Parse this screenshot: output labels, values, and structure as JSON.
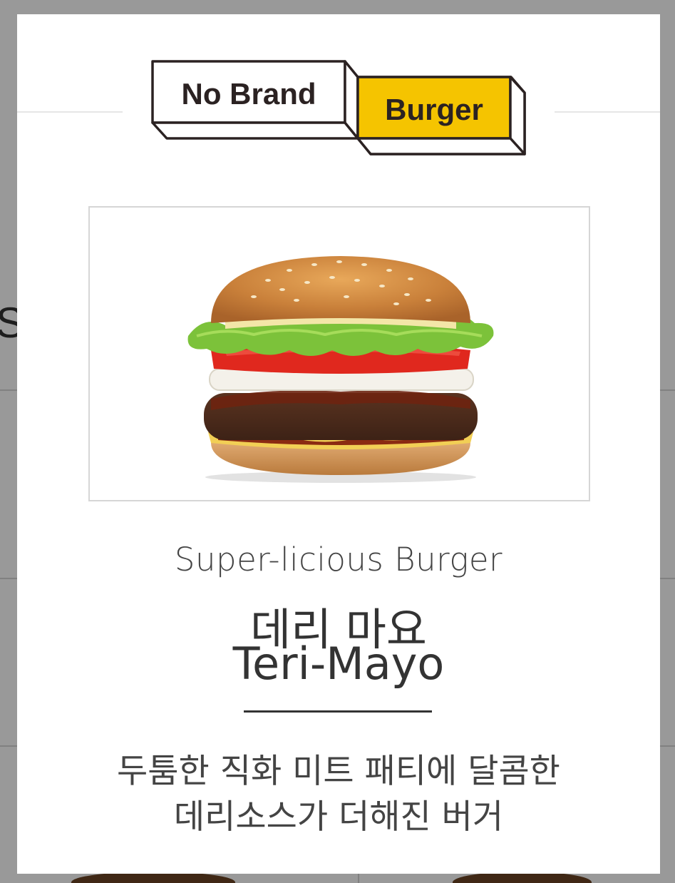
{
  "background": {
    "partial_heading_letter": "S"
  },
  "brand": {
    "word1": "No Brand",
    "word2": "Burger",
    "accent_color": "#F5C400",
    "outline_color": "#2b2222"
  },
  "product": {
    "image_icon": "burger-photo",
    "category": "Super-licious Burger",
    "name_ko": "데리 마요",
    "name_en": "Teri-Mayo",
    "description_line1": "두툼한 직화 미트 패티에 달콤한",
    "description_line2": "데리소스가 더해진 버거"
  }
}
